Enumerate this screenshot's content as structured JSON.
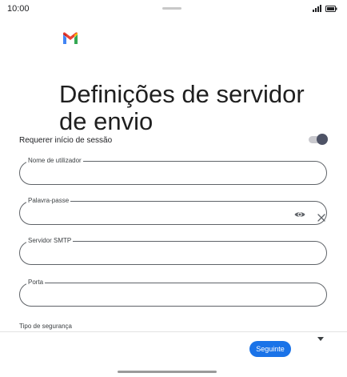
{
  "status_bar": {
    "time": "10:00"
  },
  "page": {
    "title": "Definições de servidor de envio"
  },
  "sign_in_toggle": {
    "label": "Requerer início de sessão",
    "enabled": true
  },
  "fields": {
    "username": {
      "label": "Nome de utilizador",
      "value": ""
    },
    "password": {
      "label": "Palavra-passe",
      "value": ""
    },
    "smtp_server": {
      "label": "Servidor SMTP",
      "value": ""
    },
    "port": {
      "label": "Porta",
      "value": ""
    }
  },
  "security": {
    "label": "Tipo de segurança"
  },
  "actions": {
    "next_label": "Seguinte"
  },
  "colors": {
    "accent": "#1a73e8",
    "toggle_knob": "#4e5366",
    "gmail_red": "#ea4335",
    "gmail_blue": "#4285f4",
    "gmail_green": "#34a853",
    "gmail_yellow": "#fbbc04"
  }
}
